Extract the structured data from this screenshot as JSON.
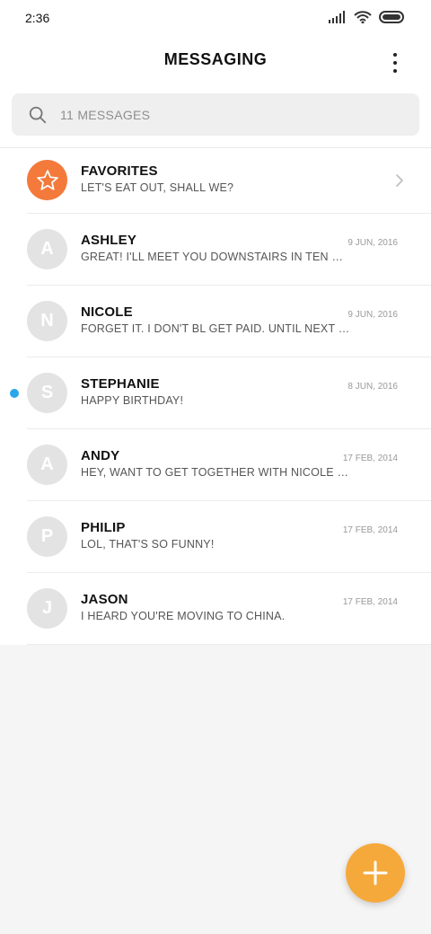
{
  "status": {
    "time": "2:36"
  },
  "app_bar": {
    "title": "MESSAGING"
  },
  "search": {
    "placeholder": "11 MESSAGES"
  },
  "conversations": [
    {
      "name": "FAVORITES",
      "snippet": "LET'S EAT OUT, SHALL WE?",
      "date": "",
      "initial": ""
    },
    {
      "name": "ASHLEY",
      "snippet": "GREAT! I'LL MEET YOU DOWNSTAIRS IN TEN MINUTES. D...",
      "date": "9 JUN, 2016",
      "initial": "A"
    },
    {
      "name": "NICOLE",
      "snippet": "FORGET IT. I DON'T BL GET PAID. UNTIL NEXT FRIDAY.",
      "date": "9 JUN, 2016",
      "initial": "N"
    },
    {
      "name": "STEPHANIE",
      "snippet": "HAPPY BIRTHDAY!",
      "date": "8 JUN, 2016",
      "initial": "S"
    },
    {
      "name": "ANDY",
      "snippet": "HEY, WANT TO GET TOGETHER WITH NICOLE ON FRIDAY?",
      "date": "17 FEB, 2014",
      "initial": "A"
    },
    {
      "name": "PHILIP",
      "snippet": "LOL, THAT'S SO FUNNY!",
      "date": "17 FEB, 2014",
      "initial": "P"
    },
    {
      "name": "JASON",
      "snippet": "I HEARD YOU'RE MOVING TO CHINA.",
      "date": "17 FEB, 2014",
      "initial": "J"
    }
  ],
  "colors": {
    "favorite": "#f37a3b",
    "unread_dot": "#2aa6ea",
    "fab": "#f6a93b"
  },
  "icons": {
    "search": "search-icon",
    "menu": "more-vert-icon",
    "favorite": "star-icon",
    "fab": "plus-icon"
  }
}
